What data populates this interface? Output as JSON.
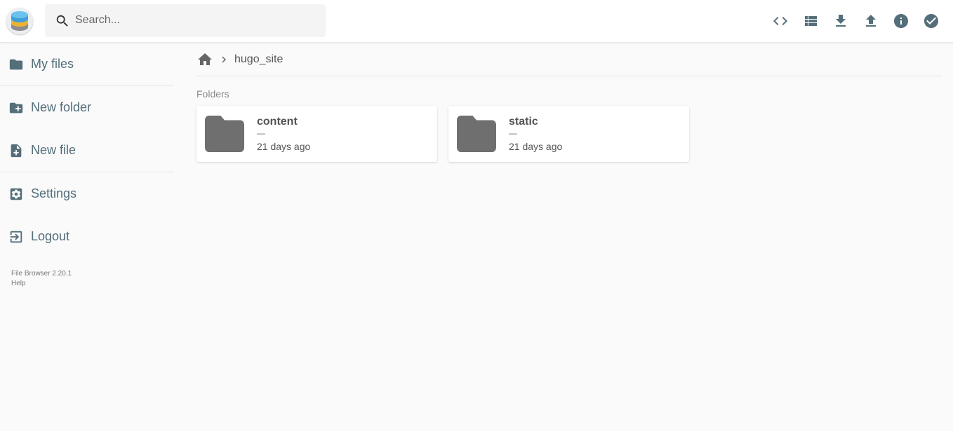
{
  "header": {
    "search": {
      "placeholder": "Search..."
    },
    "actions": [
      "code-icon",
      "list-view-icon",
      "download-icon",
      "upload-icon",
      "info-icon",
      "check-circle-icon"
    ]
  },
  "sidebar": {
    "items": [
      {
        "label": "My files",
        "icon": "folder-icon"
      },
      {
        "label": "New folder",
        "icon": "create-new-folder-icon"
      },
      {
        "label": "New file",
        "icon": "note-add-icon"
      },
      {
        "label": "Settings",
        "icon": "settings-icon"
      },
      {
        "label": "Logout",
        "icon": "exit-icon"
      }
    ],
    "footer": {
      "version": "File Browser 2.20.1",
      "help": "Help"
    }
  },
  "breadcrumb": {
    "current": "hugo_site"
  },
  "main": {
    "section_title": "Folders",
    "folders": [
      {
        "name": "content",
        "size": "—",
        "modified": "21 days ago"
      },
      {
        "name": "static",
        "size": "—",
        "modified": "21 days ago"
      }
    ]
  },
  "colors": {
    "accent": "#546e7a",
    "folder": "#6f6f6f",
    "background": "#fafafa"
  }
}
